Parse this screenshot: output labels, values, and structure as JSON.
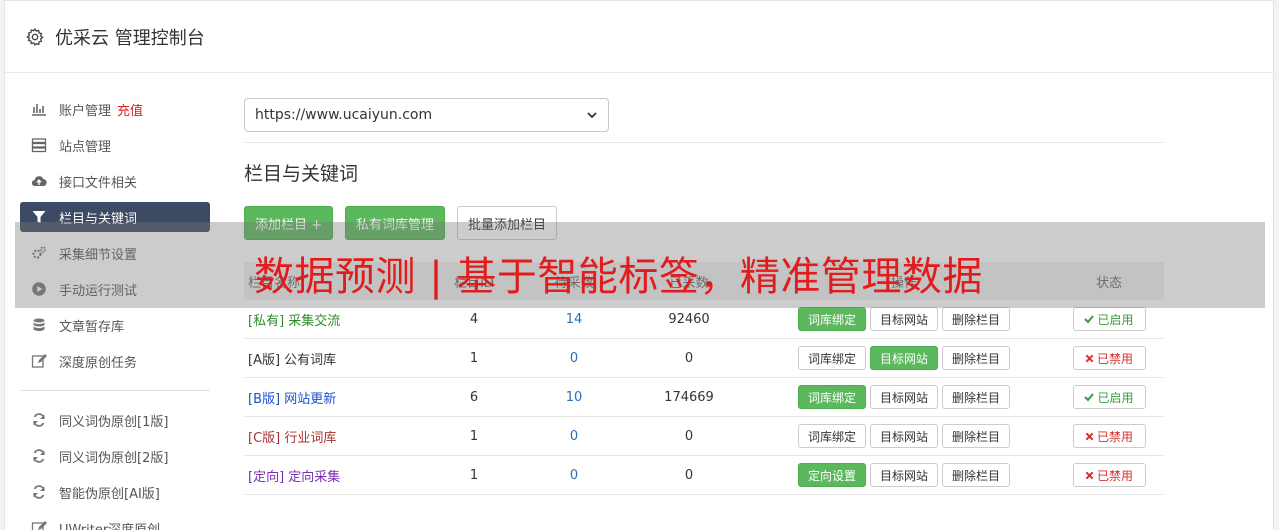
{
  "header": {
    "title": "优采云 管理控制台"
  },
  "sidebar": {
    "items": [
      {
        "label": "账户管理",
        "extra": "充值",
        "icon": "bar-chart-icon"
      },
      {
        "label": "站点管理",
        "icon": "server-icon"
      },
      {
        "label": "接口文件相关",
        "icon": "cloud-upload-icon"
      },
      {
        "label": "栏目与关键词",
        "icon": "filter-icon",
        "active": true
      },
      {
        "label": "采集细节设置",
        "icon": "gears-icon"
      },
      {
        "label": "手动运行测试",
        "icon": "play-circle-icon"
      },
      {
        "label": "文章暂存库",
        "icon": "database-icon"
      },
      {
        "label": "深度原创任务",
        "icon": "edit-icon"
      }
    ],
    "items2": [
      {
        "label": "同义词伪原创[1版]",
        "icon": "refresh-icon"
      },
      {
        "label": "同义词伪原创[2版]",
        "icon": "refresh-icon"
      },
      {
        "label": "智能伪原创[AI版]",
        "icon": "refresh-icon"
      },
      {
        "label": "UWriter深度原创",
        "icon": "edit-icon"
      }
    ]
  },
  "main": {
    "site_select": "https://www.ucaiyun.com",
    "section_title": "栏目与关键词",
    "buttons": {
      "add_column": "添加栏目 +",
      "private_lib": "私有词库管理",
      "batch_add": "批量添加栏目"
    },
    "table": {
      "headers": [
        "栏目名称",
        "栏目ID",
        "待采数",
        "已采数",
        "操作",
        "状态"
      ],
      "rows": [
        {
          "name": "[私有] 采集交流",
          "name_color": "#2e8b2e",
          "col2": "4",
          "col3": "14",
          "col4": "92460",
          "op1": "词库绑定",
          "op1_green": true,
          "op2": "目标网站",
          "op2_green": false,
          "op3": "删除栏目",
          "status": "已启用",
          "enabled": true
        },
        {
          "name": "[A版] 公有词库",
          "name_color": "#333333",
          "col2": "1",
          "col3": "0",
          "col4": "0",
          "op1": "词库绑定",
          "op1_green": false,
          "op2": "目标网站",
          "op2_green": true,
          "op3": "删除栏目",
          "status": "已禁用",
          "enabled": false
        },
        {
          "name": "[B版] 网站更新",
          "name_color": "#1f4fd1",
          "col2": "6",
          "col3": "10",
          "col4": "174669",
          "op1": "词库绑定",
          "op1_green": true,
          "op2": "目标网站",
          "op2_green": false,
          "op3": "删除栏目",
          "status": "已启用",
          "enabled": true
        },
        {
          "name": "[C版] 行业词库",
          "name_color": "#a83232",
          "col2": "1",
          "col3": "0",
          "col4": "0",
          "op1": "词库绑定",
          "op1_green": false,
          "op2": "目标网站",
          "op2_green": false,
          "op3": "删除栏目",
          "status": "已禁用",
          "enabled": false
        },
        {
          "name": "[定向] 定向采集",
          "name_color": "#7a2fb5",
          "col2": "1",
          "col3": "0",
          "col4": "0",
          "op1": "定向设置",
          "op1_green": true,
          "op2": "目标网站",
          "op2_green": false,
          "op3": "删除栏目",
          "status": "已禁用",
          "enabled": false
        }
      ]
    }
  },
  "overlay": {
    "text": "数据预测 | 基于智能标签，精准管理数据"
  }
}
